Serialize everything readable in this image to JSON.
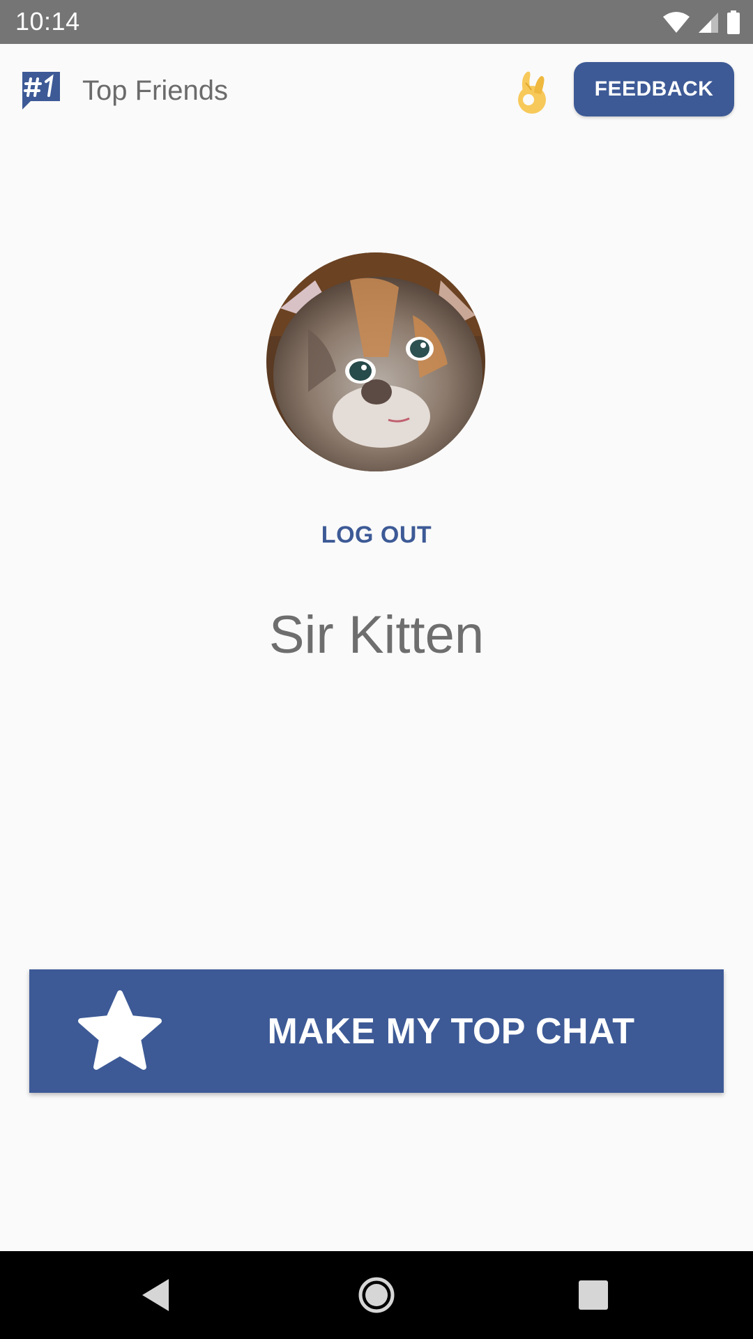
{
  "status_bar": {
    "time": "10:14",
    "icons": [
      "wifi-icon",
      "cellular-signal-icon",
      "battery-icon"
    ]
  },
  "app_bar": {
    "logo_icon": "hash-one-chat-logo-icon",
    "title": "Top Friends",
    "emoji_icon": "ok-hand-emoji-icon",
    "feedback_label": "FEEDBACK"
  },
  "profile": {
    "avatar": "kitten-avatar-photo",
    "logout_label": "LOG OUT",
    "name": "Sir Kitten"
  },
  "main_action": {
    "icon": "star-icon",
    "label": "MAKE MY TOP CHAT"
  },
  "nav_bar": {
    "icons": [
      "back-icon",
      "home-icon",
      "recents-icon"
    ]
  },
  "colors": {
    "primary": "#3d5a96",
    "background": "#fafafa",
    "status_bar": "#757575",
    "text_gray": "#6e6e6e"
  }
}
